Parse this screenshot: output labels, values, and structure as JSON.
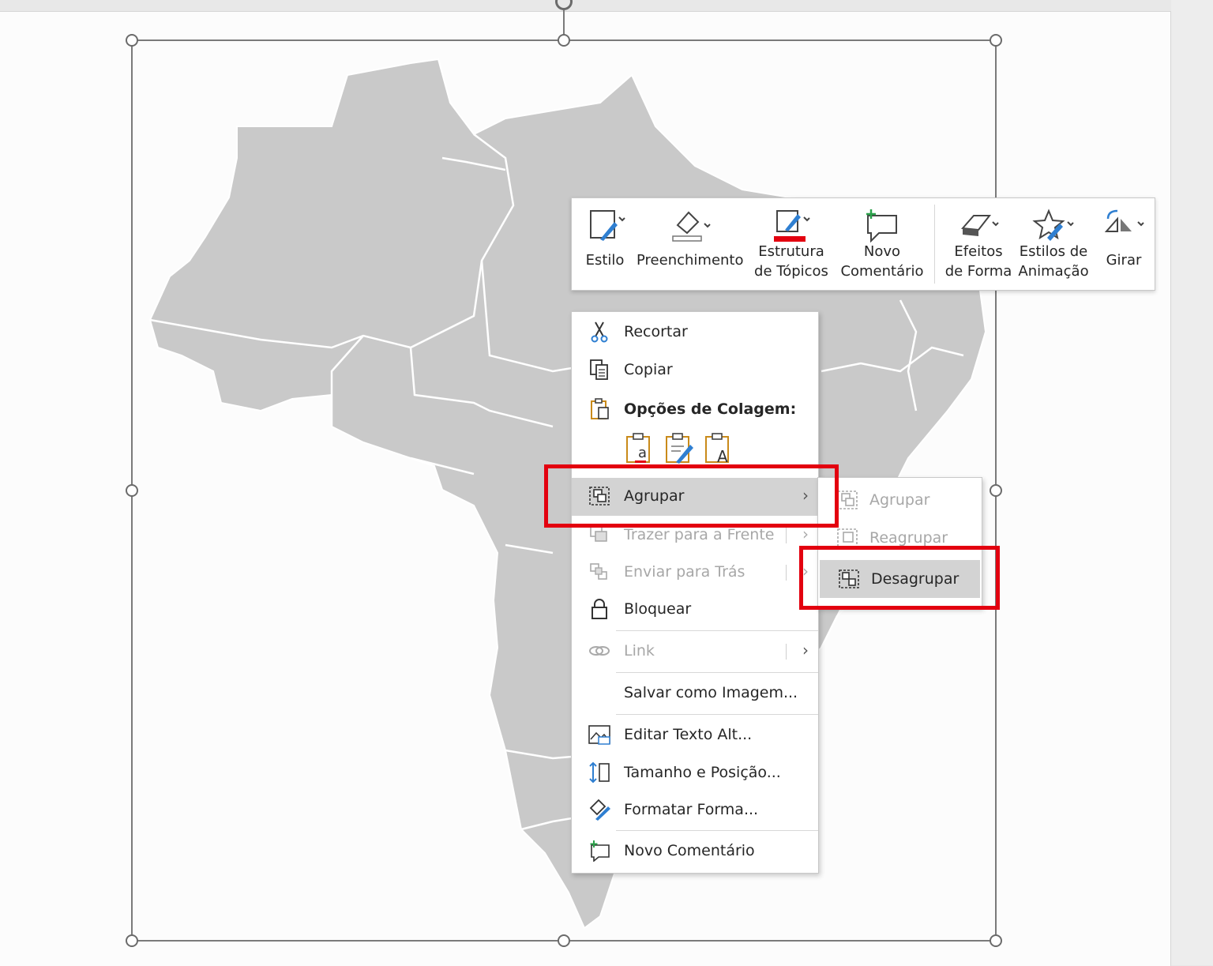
{
  "mini_toolbar": {
    "style": "Estilo",
    "fill": "Preenchimento",
    "outline_l1": "Estrutura",
    "outline_l2": "de Tópicos",
    "comment_l1": "Novo",
    "comment_l2": "Comentário",
    "effects_l1": "Efeitos",
    "effects_l2": "de Forma",
    "anim_l1": "Estilos de",
    "anim_l2": "Animação",
    "rotate": "Girar"
  },
  "context_menu": {
    "cut": "Recortar",
    "copy": "Copiar",
    "paste_options": "Opções de Colagem:",
    "group": "Agrupar",
    "bring_front": "Trazer para a Frente",
    "send_back": "Enviar para Trás",
    "lock": "Bloquear",
    "link": "Link",
    "save_image": "Salvar como Imagem...",
    "alt_text": "Editar Texto Alt...",
    "size_pos": "Tamanho e Posição...",
    "format_shape": "Formatar Forma...",
    "new_comment": "Novo Comentário"
  },
  "submenu": {
    "group": "Agrupar",
    "regroup": "Reagrupar",
    "ungroup": "Desagrupar"
  },
  "colors": {
    "highlight_box": "#e3000f",
    "map_fill": "#c9c9c9",
    "menu_hover": "#d3d3d3"
  }
}
